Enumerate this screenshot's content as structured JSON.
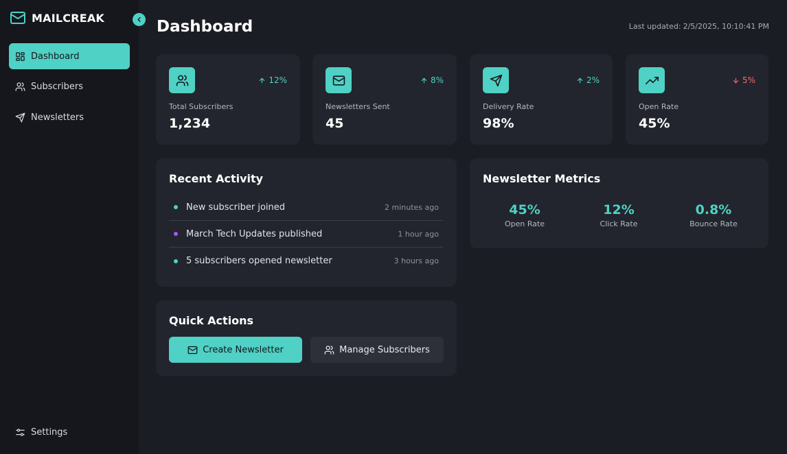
{
  "colors": {
    "accent": "#4fd1c5",
    "negative": "#f0696b",
    "purple": "#a855f7",
    "background": "#1b1d24",
    "sidebar": "#15171c",
    "card": "#22252d"
  },
  "sidebar": {
    "brand": "MAILCREAK",
    "brand_icon": "mail-icon",
    "collapse_icon": "chevron-left-icon",
    "items": [
      {
        "label": "Dashboard",
        "icon": "dashboard-icon",
        "active": true
      },
      {
        "label": "Subscribers",
        "icon": "users-icon",
        "active": false
      },
      {
        "label": "Newsletters",
        "icon": "send-icon",
        "active": false
      }
    ],
    "settings": {
      "label": "Settings",
      "icon": "sliders-icon"
    }
  },
  "header": {
    "title": "Dashboard",
    "last_updated_label": "Last updated:",
    "last_updated_value": "2/5/2025, 10:10:41 PM"
  },
  "stats": [
    {
      "label": "Total Subscribers",
      "value": "1,234",
      "change": "12%",
      "direction": "up",
      "icon": "users-icon"
    },
    {
      "label": "Newsletters Sent",
      "value": "45",
      "change": "8%",
      "direction": "up",
      "icon": "mail-icon"
    },
    {
      "label": "Delivery Rate",
      "value": "98%",
      "change": "2%",
      "direction": "up",
      "icon": "send-icon"
    },
    {
      "label": "Open Rate",
      "value": "45%",
      "change": "5%",
      "direction": "down",
      "icon": "trending-up-icon"
    }
  ],
  "recent_activity": {
    "title": "Recent Activity",
    "items": [
      {
        "text": "New subscriber joined",
        "time": "2 minutes ago",
        "dot_color": "#4fd1c5"
      },
      {
        "text": "March Tech Updates published",
        "time": "1 hour ago",
        "dot_color": "#a855f7"
      },
      {
        "text": "5 subscribers opened newsletter",
        "time": "3 hours ago",
        "dot_color": "#4fd1c5"
      }
    ]
  },
  "newsletter_metrics": {
    "title": "Newsletter Metrics",
    "items": [
      {
        "value": "45%",
        "label": "Open Rate"
      },
      {
        "value": "12%",
        "label": "Click Rate"
      },
      {
        "value": "0.8%",
        "label": "Bounce Rate"
      }
    ]
  },
  "quick_actions": {
    "title": "Quick Actions",
    "create_label": "Create Newsletter",
    "create_icon": "mail-icon",
    "manage_label": "Manage Subscribers",
    "manage_icon": "users-icon"
  }
}
